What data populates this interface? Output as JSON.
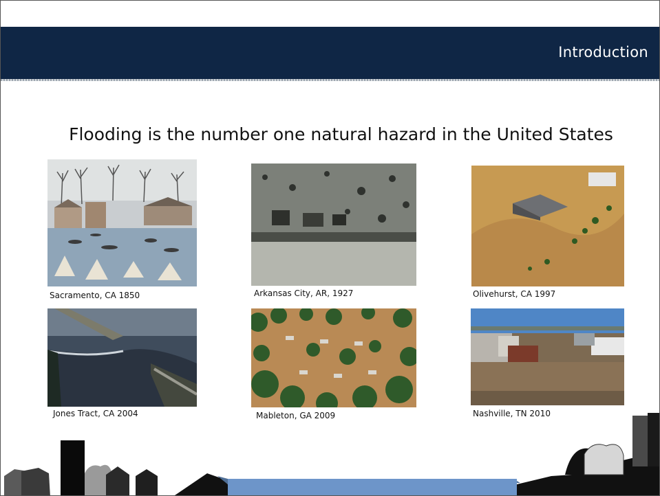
{
  "header": {
    "title": "Introduction"
  },
  "slide": {
    "heading": "Flooding is the number one natural hazard in the United States"
  },
  "photos": [
    {
      "caption": "Sacramento, CA 1850",
      "subject": "lithograph of flooded town with boats"
    },
    {
      "caption": "Arkansas City, AR, 1927",
      "subject": "black and white aerial of flooded city"
    },
    {
      "caption": "Olivehurst, CA 1997",
      "subject": "aerial of house surrounded by muddy floodwater"
    },
    {
      "caption": "Jones Tract, CA 2004",
      "subject": "levee breach with rushing water"
    },
    {
      "caption": "Mableton, GA 2009",
      "subject": "aerial of flooded neighborhood with trees"
    },
    {
      "caption": "Nashville, TN 2010",
      "subject": "flooded industrial riverfront"
    }
  ]
}
